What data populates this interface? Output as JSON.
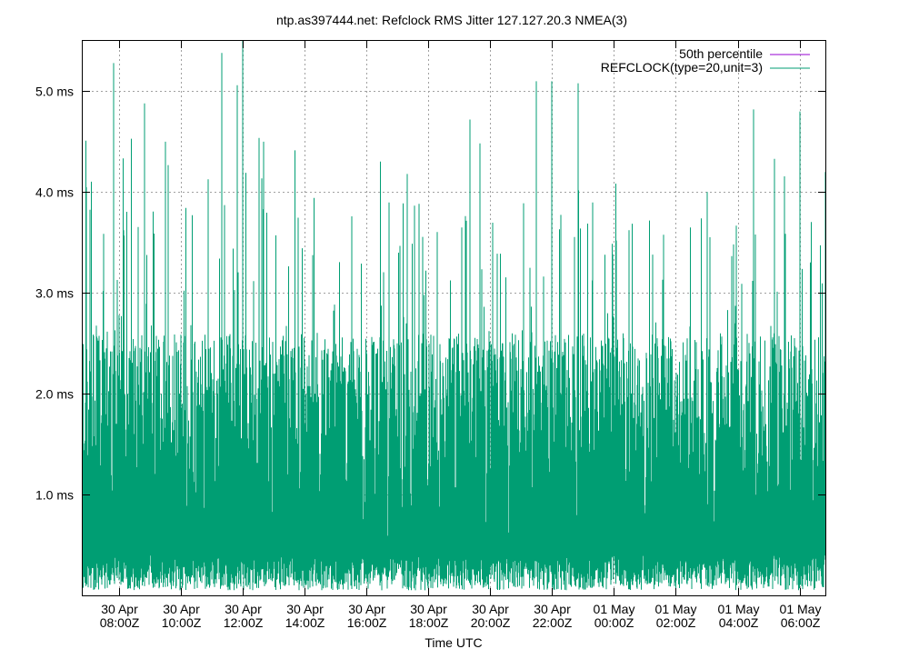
{
  "chart_data": {
    "type": "line",
    "title": "ntp.as397444.net: Refclock RMS Jitter 127.127.20.3 NMEA(3)",
    "xlabel": "Time UTC",
    "ylabel": "",
    "y_unit": "ms",
    "ylim": [
      0.0,
      5.5
    ],
    "y_ticks": [
      {
        "value": 1.0,
        "label": "1.0 ms"
      },
      {
        "value": 2.0,
        "label": "2.0 ms"
      },
      {
        "value": 3.0,
        "label": "3.0 ms"
      },
      {
        "value": 4.0,
        "label": "4.0 ms"
      },
      {
        "value": 5.0,
        "label": "5.0 ms"
      }
    ],
    "xlim": [
      "30 Apr 06:50Z",
      "01 May 06:50Z"
    ],
    "x_ticks": [
      {
        "hours_from_start": 1.1667,
        "line1": "30 Apr",
        "line2": "08:00Z"
      },
      {
        "hours_from_start": 3.1667,
        "line1": "30 Apr",
        "line2": "10:00Z"
      },
      {
        "hours_from_start": 5.1667,
        "line1": "30 Apr",
        "line2": "12:00Z"
      },
      {
        "hours_from_start": 7.1667,
        "line1": "30 Apr",
        "line2": "14:00Z"
      },
      {
        "hours_from_start": 9.1667,
        "line1": "30 Apr",
        "line2": "16:00Z"
      },
      {
        "hours_from_start": 11.1667,
        "line1": "30 Apr",
        "line2": "18:00Z"
      },
      {
        "hours_from_start": 13.1667,
        "line1": "30 Apr",
        "line2": "20:00Z"
      },
      {
        "hours_from_start": 15.1667,
        "line1": "30 Apr",
        "line2": "22:00Z"
      },
      {
        "hours_from_start": 17.1667,
        "line1": "01 May",
        "line2": "00:00Z"
      },
      {
        "hours_from_start": 19.1667,
        "line1": "01 May",
        "line2": "02:00Z"
      },
      {
        "hours_from_start": 21.1667,
        "line1": "01 May",
        "line2": "04:00Z"
      },
      {
        "hours_from_start": 23.1667,
        "line1": "01 May",
        "line2": "06:00Z"
      }
    ],
    "grid": true,
    "legend_position": "top-right",
    "series": [
      {
        "name": "50th percentile",
        "color": "#9400d3",
        "values": []
      },
      {
        "name": "REFCLOCK(type=20,unit=3)",
        "color": "#009e73",
        "style": "dense impulses",
        "typical_band_ms": [
          0.3,
          2.6
        ],
        "peaks": [
          {
            "time": "30 Apr 07:50Z",
            "value": 5.28
          },
          {
            "time": "30 Apr 07:50Z",
            "value": 4.88
          },
          {
            "time": "30 Apr 08:50Z",
            "value": 4.88
          },
          {
            "time": "30 Apr 09:30Z",
            "value": 4.5
          },
          {
            "time": "30 Apr 11:20Z",
            "value": 5.38
          },
          {
            "time": "30 Apr 12:00Z",
            "value": 5.5
          },
          {
            "time": "30 Apr 11:50Z",
            "value": 5.06
          },
          {
            "time": "30 Apr 12:40Z",
            "value": 4.5
          },
          {
            "time": "30 Apr 17:20Z",
            "value": 4.18
          },
          {
            "time": "30 Apr 19:20Z",
            "value": 4.72
          },
          {
            "time": "30 Apr 21:30Z",
            "value": 5.1
          },
          {
            "time": "30 Apr 22:00Z",
            "value": 5.1
          },
          {
            "time": "30 Apr 22:50Z",
            "value": 5.08
          },
          {
            "time": "01 May 04:30Z",
            "value": 4.82
          },
          {
            "time": "01 May 06:00Z",
            "value": 4.8
          },
          {
            "time": "01 May 06:50Z",
            "value": 4.2
          }
        ]
      }
    ]
  }
}
